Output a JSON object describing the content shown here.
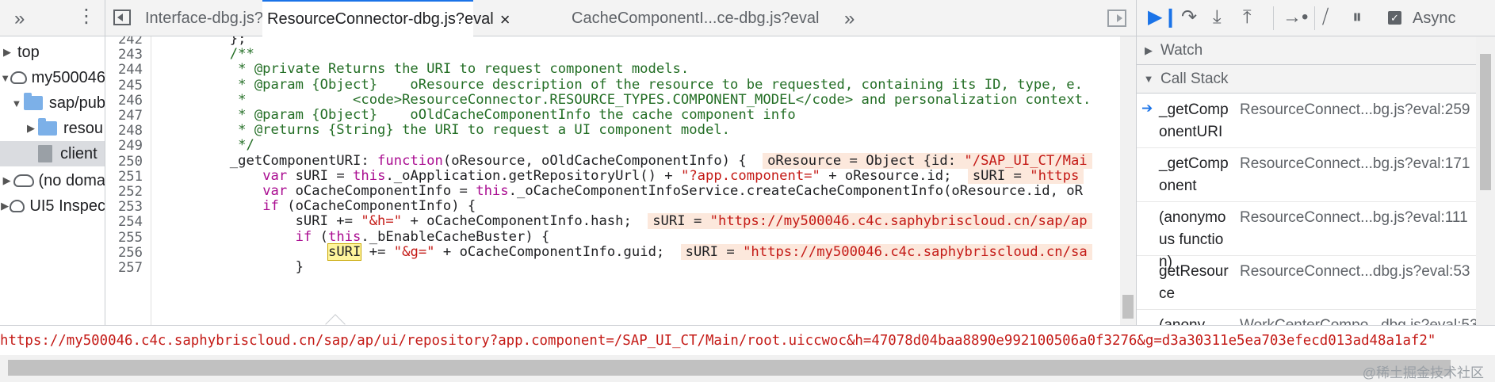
{
  "navigator": {
    "items": [
      {
        "label": "top",
        "depth": 0,
        "kind": "frame",
        "expanded": false
      },
      {
        "label": "my500046",
        "depth": 0,
        "kind": "cloud",
        "expanded": true
      },
      {
        "label": "sap/pub",
        "depth": 1,
        "kind": "folder",
        "expanded": true
      },
      {
        "label": "resou",
        "depth": 2,
        "kind": "folder",
        "expanded": false
      },
      {
        "label": "client",
        "depth": 2,
        "kind": "file",
        "selected": true
      },
      {
        "label": "(no doma",
        "depth": 0,
        "kind": "cloud",
        "expanded": false
      },
      {
        "label": "UI5 Inspec",
        "depth": 0,
        "kind": "cloud",
        "expanded": false
      }
    ]
  },
  "editor": {
    "tabs": [
      {
        "label": "Interface-dbg.js?eval",
        "active": false
      },
      {
        "label": "ResourceConnector-dbg.js?eval",
        "active": true,
        "close": "×"
      },
      {
        "label": "CacheComponentI...ce-dbg.js?eval",
        "active": false
      }
    ],
    "lines": [
      {
        "num": "242",
        "html": "        };"
      },
      {
        "num": "243",
        "html": "        <span class=\"cm\">/**</span>"
      },
      {
        "num": "244",
        "html": "<span class=\"cm\">         * @private Returns the URI to request component models.</span>"
      },
      {
        "num": "245",
        "html": "<span class=\"cm\">         * @param {Object}    oResource description of the resource to be requested, containing its ID, type, e.</span>"
      },
      {
        "num": "246",
        "html": "<span class=\"cm\">         *             &lt;code&gt;ResourceConnector.RESOURCE_TYPES.COMPONENT_MODEL&lt;/code&gt; and personalization context.</span>"
      },
      {
        "num": "247",
        "html": "<span class=\"cm\">         * @param {Object}    oOldCacheComponentInfo the cache component info</span>"
      },
      {
        "num": "248",
        "html": "<span class=\"cm\">         * @returns {String} the URI to request a UI component model.</span>"
      },
      {
        "num": "249",
        "html": "<span class=\"cm\">         */</span>"
      },
      {
        "num": "250",
        "html": "        _getComponentURI: <span class=\"kw\">function</span>(oResource, oOldCacheComponentInfo) { <span class=\"ev\">oResource = Object {id: <span class=\"st\">\"/SAP_UI_CT/Mai</span></span>"
      },
      {
        "num": "251",
        "html": "            <span class=\"kw\">var</span> sURI = <span class=\"kw\">this</span>._oApplication.getRepositoryUrl() + <span class=\"st\">\"?app.component=\"</span> + oResource.id; <span class=\"ev\">sURI = <span class=\"st\">\"https</span></span>"
      },
      {
        "num": "252",
        "html": "            <span class=\"kw\">var</span> oCacheComponentInfo = <span class=\"kw\">this</span>._oCacheComponentInfoService.createCacheComponentInfo(oResource.id, oR"
      },
      {
        "num": "253",
        "html": "            <span class=\"kw\">if</span> (oCacheComponentInfo) {"
      },
      {
        "num": "254",
        "html": "                sURI += <span class=\"st\">\"&amp;h=\"</span> + oCacheComponentInfo.hash; <span class=\"ev\">sURI = <span class=\"st\">\"https://my500046.c4c.saphybriscloud.cn/sap/ap</span></span>"
      },
      {
        "num": "255",
        "html": "                <span class=\"kw\">if</span> (<span class=\"kw\">this</span>._bEnableCacheBuster) {"
      },
      {
        "num": "256",
        "html": "                    <span class=\"hl\">sURI</span> += <span class=\"st\">\"&amp;g=\"</span> + oCacheComponentInfo.guid; <span class=\"ev\">sURI = <span class=\"st\">\"https://my500046.c4c.saphybriscloud.cn/sa</span></span>"
      },
      {
        "num": "257",
        "html": "                }"
      }
    ],
    "tooltip": "https://my500046.c4c.saphybriscloud.cn/sap/ap/ui/repository?app.component=/SAP_UI_CT/Main/root.uiccwoc&h=47078d04baa8890e992100506a0f3276&g=d3a30311e5ea703efecd013ad48a1af2\""
  },
  "debugger": {
    "async_label": "Async",
    "async_checked": true,
    "watch_label": "Watch",
    "callstack_label": "Call Stack",
    "frames": [
      {
        "fn": "_getComponentURI",
        "loc": "ResourceConnect...bg.js?eval:259",
        "current": true
      },
      {
        "fn": "_getComponent",
        "loc": "ResourceConnect...bg.js?eval:171",
        "current": false
      },
      {
        "fn": "(anonymous function)",
        "loc": "ResourceConnect...bg.js?eval:111",
        "current": false
      },
      {
        "fn": "getResource",
        "loc": "ResourceConnect...dbg.js?eval:53",
        "current": false
      },
      {
        "fn": "(anony",
        "loc": "WorkCenterCompo...dbg.js?eval:53",
        "current": false
      }
    ]
  },
  "watermark": "@稀土掘金技术社区"
}
